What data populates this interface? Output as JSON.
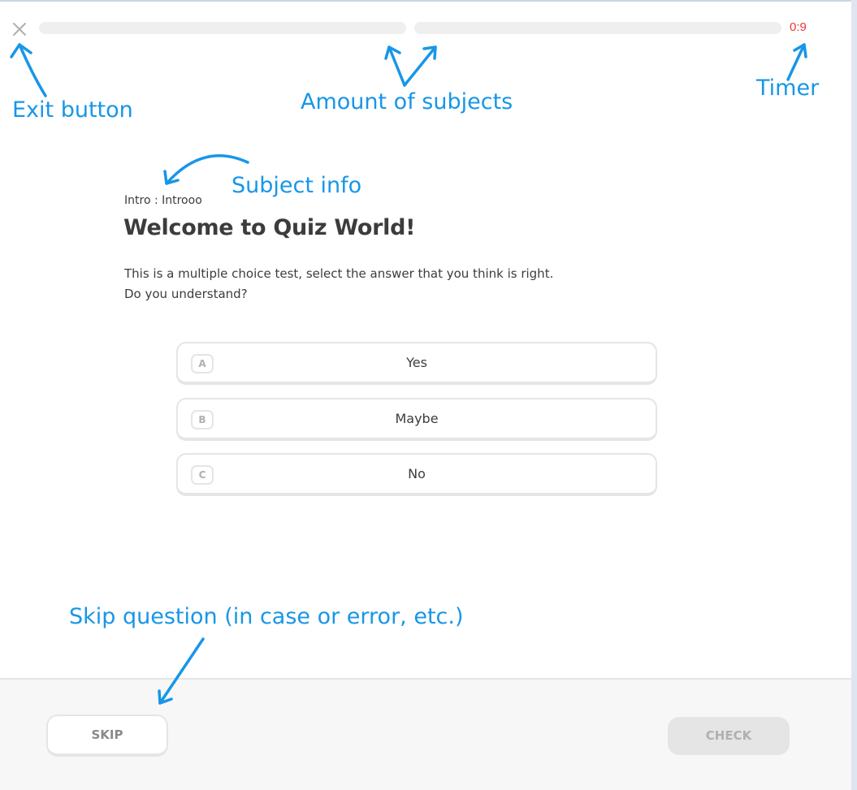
{
  "header": {
    "timer": "0:9",
    "progress_segments": [
      {
        "name": "subject-1",
        "fill": 0
      },
      {
        "name": "subject-2",
        "fill": 0
      }
    ]
  },
  "question": {
    "subject_info": "Intro : Introoo",
    "title": "Welcome to Quiz World!",
    "description_line1": "This is a multiple choice test, select the answer that you think is right.",
    "description_line2": "Do you understand?"
  },
  "choices": [
    {
      "key": "A",
      "label": "Yes"
    },
    {
      "key": "B",
      "label": "Maybe"
    },
    {
      "key": "C",
      "label": "No"
    }
  ],
  "footer": {
    "skip_label": "SKIP",
    "check_label": "CHECK"
  },
  "annotations": {
    "exit": "Exit button",
    "subjects": "Amount of subjects",
    "timer": "Timer",
    "subject_info": "Subject info",
    "skip": "Skip question (in case or error, etc.)"
  },
  "colors": {
    "annotation": "#1896e8",
    "timer": "#e5383b",
    "progress_track": "#efefef",
    "button_border": "#e5e5e5"
  },
  "icons": {
    "exit": "close-icon"
  }
}
